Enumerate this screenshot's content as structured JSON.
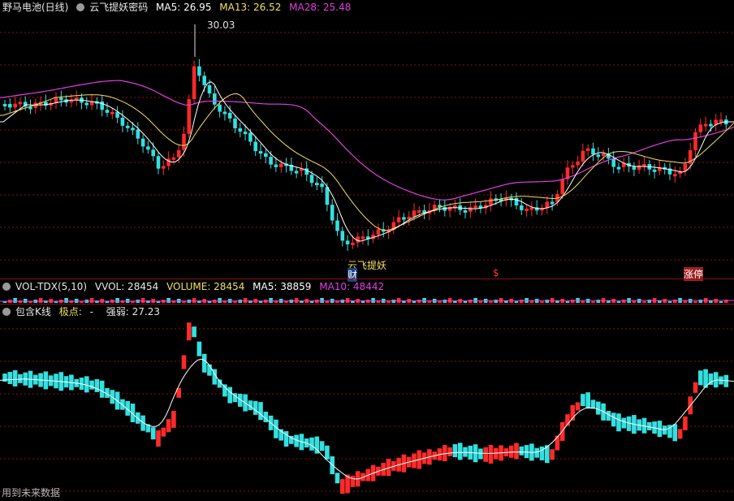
{
  "main": {
    "title": "野马电池(日线)",
    "indicator_name": "云飞提妖密码",
    "ma5": "MA5: 26.95",
    "ma13": "MA13: 26.52",
    "ma28": "MA28: 25.48",
    "peak_label": "30.03",
    "marker_1": "云飞提妖",
    "marker_2": "财",
    "marker_3": "$",
    "marker_4": "涨停"
  },
  "vol": {
    "name": "VOL-TDX(5,10)",
    "vvol": "VVOL: 28454",
    "volume": "VOLUME: 28454",
    "ma5": "MA5: 38859",
    "ma10": "MA10: 48442"
  },
  "ind": {
    "name": "包含K线",
    "extreme_label": "极点:",
    "extreme_value": "-",
    "strength": "强弱: 27.23"
  },
  "footer": "用到未来数据",
  "colors": {
    "up": "#ff2a2a",
    "down": "#33e0e0",
    "ma5": "#ffffff",
    "ma13": "#f0e060",
    "ma28": "#e040e0",
    "grid": "#8a1010"
  },
  "chart_data": {
    "type": "candlestick",
    "peak_high": 30.03,
    "mas": {
      "MA5": 26.95,
      "MA13": 26.52,
      "MA28": 25.48
    },
    "volume": {
      "VVOL": 28454,
      "VOLUME": 28454,
      "MA5": 38859,
      "MA10": 48442
    },
    "strength": 27.23
  }
}
